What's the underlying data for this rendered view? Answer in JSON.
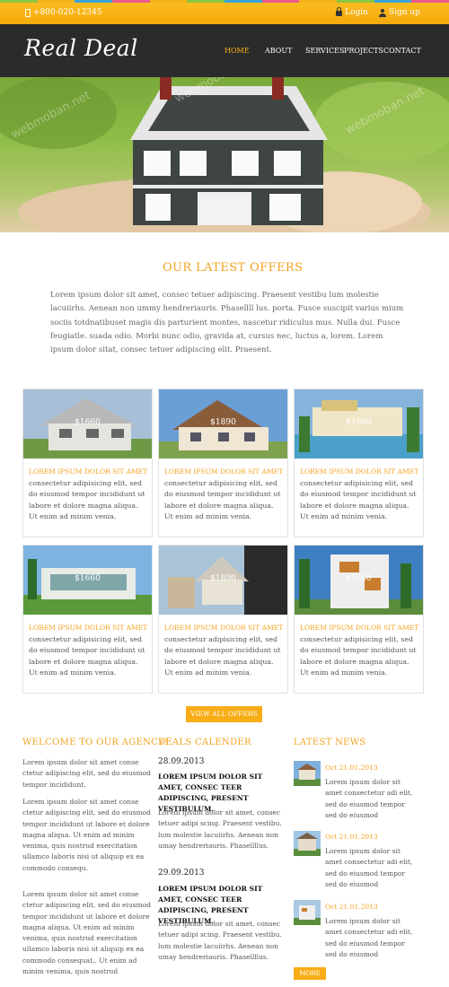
{
  "topbar": {
    "phone": "+800-020-12345",
    "login": "Login",
    "signup": "Sign up",
    "stripe_colors": [
      "#8cc63f",
      "#f7b11a",
      "#3aa3d8",
      "#ec5b8b",
      "#f7b11a",
      "#8cc63f",
      "#3aa3d8",
      "#ec5b8b",
      "#f7b11a",
      "#8cc63f",
      "#3aa3d8",
      "#ec5b8b"
    ]
  },
  "nav": {
    "logo": "Real Deal",
    "items": [
      "HOME",
      "ABOUT",
      "SERVICES",
      "PROJECTS",
      "CONTACT"
    ],
    "active": "HOME"
  },
  "slider": {
    "dots": 5,
    "active_index": 0
  },
  "watermark": "webmoban.net",
  "offers": {
    "title": "OUR LATEST OFFERS",
    "intro": "Lorem ipsum dolor sit amet, consec tetuer adipiscing. Praesent vestibu lum molestie lacuiirhs. Aenean non ummy hendreriauris. Phasellll lus. porta. Fusce suscipit varius mium sociis totdnatibuset magis dis parturient montes, nascetur ridiculus mus. Nulla dui. Fusce feugiatle. suada odio. Morbi nunc odio, gravida at, cursus nec, luctus a, lorem. Lorem ipsum dolor sitat, consec tetuer adipiscing elit. Praesent.",
    "cards": [
      {
        "price": "$1660",
        "title": "LOREM IPSUM DOLOR SIT AMET",
        "text": "consectetur adipisicing elit, sed do eiusmod tempor incididunt ut labore et dolore magna aliqua. Ut enim ad minim venia."
      },
      {
        "price": "$1890",
        "title": "LOREM IPSUM DOLOR SIT AMET",
        "text": "consectetur adipisicing elit, sed do eiusmod tempor incididunt ut labore et dolore magna aliqua. Ut enim ad minim venia."
      },
      {
        "price": "$1660",
        "title": "LOREM IPSUM DOLOR SIT AMET",
        "text": "consectetur adipisicing elit, sed do eiusmod tempor incididunt ut labore et dolore magna aliqua. Ut enim ad minim venia."
      },
      {
        "price": "$1660",
        "title": "LOREM IPSUM DOLOR SIT AMET",
        "text": "consectetur adipisicing elit, sed do eiusmod tempor incididunt ut labore et dolore magna aliqua. Ut enim ad minim venia."
      },
      {
        "price": "$1890",
        "title": "LOREM IPSUM DOLOR SIT AMET",
        "text": "consectetur adipisicing elit, sed do eiusmod tempor incididunt ut labore et dolore magna aliqua. Ut enim ad minim venia."
      },
      {
        "price": "$1660",
        "title": "LOREM IPSUM DOLOR SIT AMET",
        "text": "consectetur adipisicing elit, sed do eiusmod tempor incididunt ut labore et dolore magna aliqua. Ut enim ad minim venia."
      }
    ],
    "view_all": "VIEW ALL OFFERS"
  },
  "agency": {
    "title": "WELCOME TO OUR AGENCY!",
    "paragraphs": [
      "Lorem ipsum dolor sit amet conse ctetur adipiscing elit, sed do eiusmod tempor incididunt.",
      "Lorem ipsum dolor sit amet conse ctetur adipiscing elit, sed do eiusmod tempor incididunt ut labore et dolore magna aliqua. Ut enim ad minim venima, quis nostrud exercitation ullamco laboris nisi ut aliquip ex ea commodo consequ.",
      "Lorem ipsum dolor sit amet conse ctetur adipiscing elit, sed do eiusmod tempor incididunt ut labore et dolore magna aliqua. Ut enim ad minim venima, quis nostrud exercitation ullamco laboris nisi ut aliquip ex ea commodo consequat,. Ut enim ad minim venima, quis nostrud"
    ]
  },
  "deals": {
    "title": "DEALS CALENDER",
    "items": [
      {
        "date": "28.09.2013",
        "heading": "LOREM IPSUM DOLOR SIT AMET, CONSEC TEER ADIPISCING, PRESENT VESTIBULUM.",
        "text": "Lorem ipsum dolor sit amet, consec tetuer adipi scing. Praesent vestibu. lum molestie lacuiirhs. Aenean non umay hendreriauris. Phasellllus."
      },
      {
        "date": "29.09.2013",
        "heading": "LOREM IPSUM DOLOR SIT AMET, CONSEC TEER ADIPISCING, PRESENT VESTIBULUM.",
        "text": "Lorem ipsum dolor sit amet, consec tetuer adipi scing. Praesent vestibu. lum molestie lacuiirhs. Aenean non umay hendreriauris. Phasellllus."
      }
    ]
  },
  "news": {
    "title": "LATEST NEWS",
    "items": [
      {
        "date": "Oct 21.01.2013",
        "text": "Lorem ipsum dolor sit amet consectetur adi elit, sed do eiusmod tempor sed do eiusmod"
      },
      {
        "date": "Oct 21.01.2013",
        "text": "Lorem ipsum dolor sit amet consectetur adi elit, sed do eiusmod tempor sed do eiusmod"
      },
      {
        "date": "Oct 21.01.2013",
        "text": "Lorem ipsum dolor sit amet consectetur adi elit, sed do eiusmod tempor sed do eiusmod"
      }
    ],
    "more": "MORE"
  }
}
